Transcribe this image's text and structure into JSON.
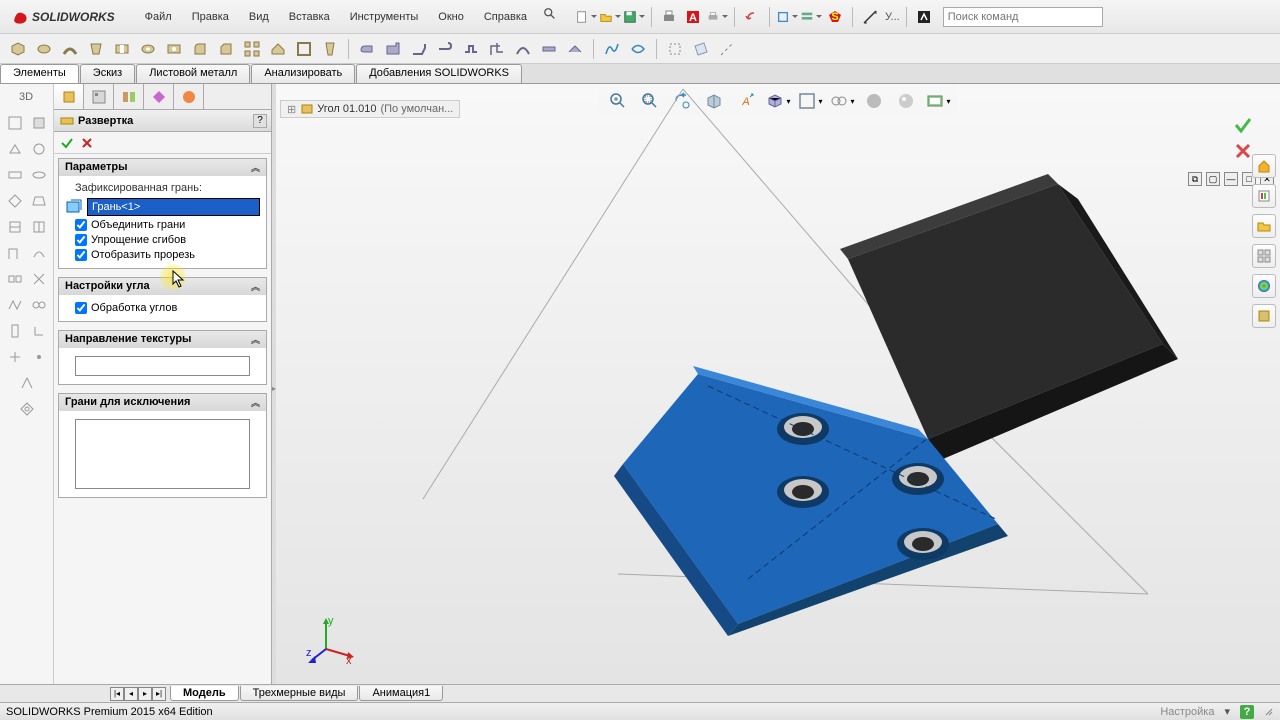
{
  "app": {
    "logo_text": "SOLIDWORKS",
    "search_placeholder": "Поиск команд"
  },
  "menu": [
    "Файл",
    "Правка",
    "Вид",
    "Вставка",
    "Инструменты",
    "Окно",
    "Справка"
  ],
  "tabs": {
    "items": [
      "Элементы",
      "Эскиз",
      "Листовой металл",
      "Анализировать",
      "Добавления SOLIDWORKS"
    ],
    "active_index": 0
  },
  "document": {
    "name": "Угол 01.010",
    "config": "(По умолчан..."
  },
  "property_manager": {
    "title": "Развертка",
    "groups": {
      "params": {
        "title": "Параметры",
        "fixed_face_label": "Зафиксированная грань:",
        "selection": "Грань<1>",
        "checks": [
          "Объединить грани",
          "Упрощение сгибов",
          "Отобразить прорезь"
        ]
      },
      "corner": {
        "title": "Настройки угла",
        "check": "Обработка углов"
      },
      "texture": {
        "title": "Направление текстуры"
      },
      "exclude": {
        "title": "Грани для исключения"
      }
    }
  },
  "bottom_tabs": {
    "items": [
      "Модель",
      "Трехмерные виды",
      "Анимация1"
    ],
    "active_index": 0
  },
  "status": {
    "left": "SOLIDWORKS Premium 2015 x64 Edition",
    "right": "Настройка",
    "help": "?"
  },
  "colors": {
    "part_blue": "#1e66b8",
    "part_dark": "#2b2b2b"
  },
  "triad": {
    "x": "x",
    "y": "y",
    "z": "z"
  }
}
